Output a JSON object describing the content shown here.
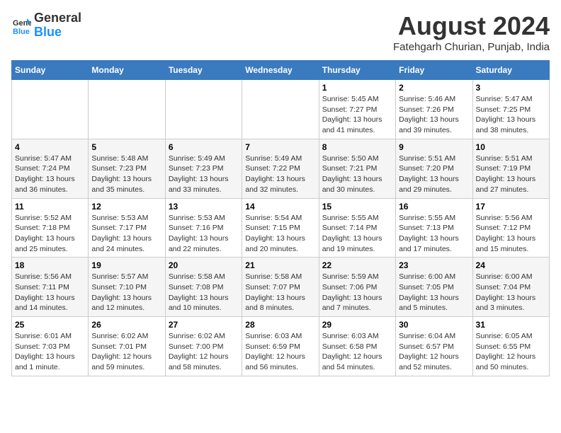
{
  "header": {
    "logo_general": "General",
    "logo_blue": "Blue",
    "month_year": "August 2024",
    "location": "Fatehgarh Churian, Punjab, India"
  },
  "days_of_week": [
    "Sunday",
    "Monday",
    "Tuesday",
    "Wednesday",
    "Thursday",
    "Friday",
    "Saturday"
  ],
  "weeks": [
    [
      {
        "day": "",
        "info": ""
      },
      {
        "day": "",
        "info": ""
      },
      {
        "day": "",
        "info": ""
      },
      {
        "day": "",
        "info": ""
      },
      {
        "day": "1",
        "info": "Sunrise: 5:45 AM\nSunset: 7:27 PM\nDaylight: 13 hours\nand 41 minutes."
      },
      {
        "day": "2",
        "info": "Sunrise: 5:46 AM\nSunset: 7:26 PM\nDaylight: 13 hours\nand 39 minutes."
      },
      {
        "day": "3",
        "info": "Sunrise: 5:47 AM\nSunset: 7:25 PM\nDaylight: 13 hours\nand 38 minutes."
      }
    ],
    [
      {
        "day": "4",
        "info": "Sunrise: 5:47 AM\nSunset: 7:24 PM\nDaylight: 13 hours\nand 36 minutes."
      },
      {
        "day": "5",
        "info": "Sunrise: 5:48 AM\nSunset: 7:23 PM\nDaylight: 13 hours\nand 35 minutes."
      },
      {
        "day": "6",
        "info": "Sunrise: 5:49 AM\nSunset: 7:23 PM\nDaylight: 13 hours\nand 33 minutes."
      },
      {
        "day": "7",
        "info": "Sunrise: 5:49 AM\nSunset: 7:22 PM\nDaylight: 13 hours\nand 32 minutes."
      },
      {
        "day": "8",
        "info": "Sunrise: 5:50 AM\nSunset: 7:21 PM\nDaylight: 13 hours\nand 30 minutes."
      },
      {
        "day": "9",
        "info": "Sunrise: 5:51 AM\nSunset: 7:20 PM\nDaylight: 13 hours\nand 29 minutes."
      },
      {
        "day": "10",
        "info": "Sunrise: 5:51 AM\nSunset: 7:19 PM\nDaylight: 13 hours\nand 27 minutes."
      }
    ],
    [
      {
        "day": "11",
        "info": "Sunrise: 5:52 AM\nSunset: 7:18 PM\nDaylight: 13 hours\nand 25 minutes."
      },
      {
        "day": "12",
        "info": "Sunrise: 5:53 AM\nSunset: 7:17 PM\nDaylight: 13 hours\nand 24 minutes."
      },
      {
        "day": "13",
        "info": "Sunrise: 5:53 AM\nSunset: 7:16 PM\nDaylight: 13 hours\nand 22 minutes."
      },
      {
        "day": "14",
        "info": "Sunrise: 5:54 AM\nSunset: 7:15 PM\nDaylight: 13 hours\nand 20 minutes."
      },
      {
        "day": "15",
        "info": "Sunrise: 5:55 AM\nSunset: 7:14 PM\nDaylight: 13 hours\nand 19 minutes."
      },
      {
        "day": "16",
        "info": "Sunrise: 5:55 AM\nSunset: 7:13 PM\nDaylight: 13 hours\nand 17 minutes."
      },
      {
        "day": "17",
        "info": "Sunrise: 5:56 AM\nSunset: 7:12 PM\nDaylight: 13 hours\nand 15 minutes."
      }
    ],
    [
      {
        "day": "18",
        "info": "Sunrise: 5:56 AM\nSunset: 7:11 PM\nDaylight: 13 hours\nand 14 minutes."
      },
      {
        "day": "19",
        "info": "Sunrise: 5:57 AM\nSunset: 7:10 PM\nDaylight: 13 hours\nand 12 minutes."
      },
      {
        "day": "20",
        "info": "Sunrise: 5:58 AM\nSunset: 7:08 PM\nDaylight: 13 hours\nand 10 minutes."
      },
      {
        "day": "21",
        "info": "Sunrise: 5:58 AM\nSunset: 7:07 PM\nDaylight: 13 hours\nand 8 minutes."
      },
      {
        "day": "22",
        "info": "Sunrise: 5:59 AM\nSunset: 7:06 PM\nDaylight: 13 hours\nand 7 minutes."
      },
      {
        "day": "23",
        "info": "Sunrise: 6:00 AM\nSunset: 7:05 PM\nDaylight: 13 hours\nand 5 minutes."
      },
      {
        "day": "24",
        "info": "Sunrise: 6:00 AM\nSunset: 7:04 PM\nDaylight: 13 hours\nand 3 minutes."
      }
    ],
    [
      {
        "day": "25",
        "info": "Sunrise: 6:01 AM\nSunset: 7:03 PM\nDaylight: 13 hours\nand 1 minute."
      },
      {
        "day": "26",
        "info": "Sunrise: 6:02 AM\nSunset: 7:01 PM\nDaylight: 12 hours\nand 59 minutes."
      },
      {
        "day": "27",
        "info": "Sunrise: 6:02 AM\nSunset: 7:00 PM\nDaylight: 12 hours\nand 58 minutes."
      },
      {
        "day": "28",
        "info": "Sunrise: 6:03 AM\nSunset: 6:59 PM\nDaylight: 12 hours\nand 56 minutes."
      },
      {
        "day": "29",
        "info": "Sunrise: 6:03 AM\nSunset: 6:58 PM\nDaylight: 12 hours\nand 54 minutes."
      },
      {
        "day": "30",
        "info": "Sunrise: 6:04 AM\nSunset: 6:57 PM\nDaylight: 12 hours\nand 52 minutes."
      },
      {
        "day": "31",
        "info": "Sunrise: 6:05 AM\nSunset: 6:55 PM\nDaylight: 12 hours\nand 50 minutes."
      }
    ]
  ]
}
